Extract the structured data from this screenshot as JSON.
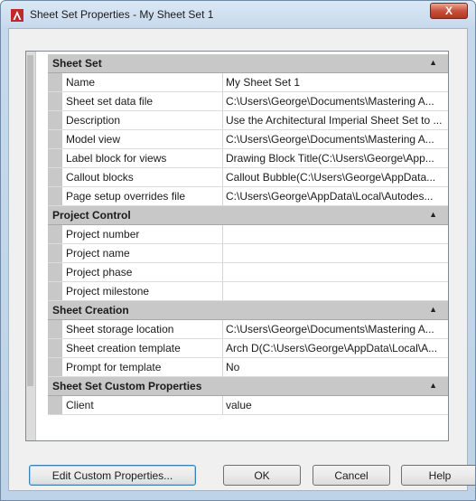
{
  "window": {
    "title": "Sheet Set Properties - My Sheet Set 1",
    "close_label": "X",
    "close_icon": "close-icon",
    "app_icon": "autocad-icon"
  },
  "sections": [
    {
      "label": "Sheet Set",
      "properties": [
        {
          "name": "Name",
          "value": "My Sheet Set 1"
        },
        {
          "name": "Sheet set data file",
          "value": "C:\\Users\\George\\Documents\\Mastering A..."
        },
        {
          "name": "Description",
          "value": "Use the Architectural Imperial Sheet Set to ..."
        },
        {
          "name": "Model view",
          "value": "C:\\Users\\George\\Documents\\Mastering A..."
        },
        {
          "name": "Label block for views",
          "value": "Drawing Block Title(C:\\Users\\George\\App..."
        },
        {
          "name": "Callout blocks",
          "value": "Callout Bubble(C:\\Users\\George\\AppData..."
        },
        {
          "name": "Page setup overrides file",
          "value": "C:\\Users\\George\\AppData\\Local\\Autodes..."
        }
      ]
    },
    {
      "label": "Project Control",
      "properties": [
        {
          "name": "Project number",
          "value": ""
        },
        {
          "name": "Project name",
          "value": ""
        },
        {
          "name": "Project phase",
          "value": ""
        },
        {
          "name": "Project milestone",
          "value": ""
        }
      ]
    },
    {
      "label": "Sheet Creation",
      "properties": [
        {
          "name": "Sheet storage location",
          "value": "C:\\Users\\George\\Documents\\Mastering A..."
        },
        {
          "name": "Sheet creation template",
          "value": "Arch D(C:\\Users\\George\\AppData\\Local\\A..."
        },
        {
          "name": "Prompt for template",
          "value": "No"
        }
      ]
    },
    {
      "label": "Sheet Set Custom Properties",
      "properties": [
        {
          "name": "Client",
          "value": "value"
        }
      ]
    }
  ],
  "buttons": {
    "edit_custom": "Edit Custom Properties...",
    "ok": "OK",
    "cancel": "Cancel",
    "help": "Help"
  },
  "colors": {
    "close_button": "#c9513d",
    "category_bg": "#c8c8c8",
    "default_button_border": "#3c7fb1"
  }
}
